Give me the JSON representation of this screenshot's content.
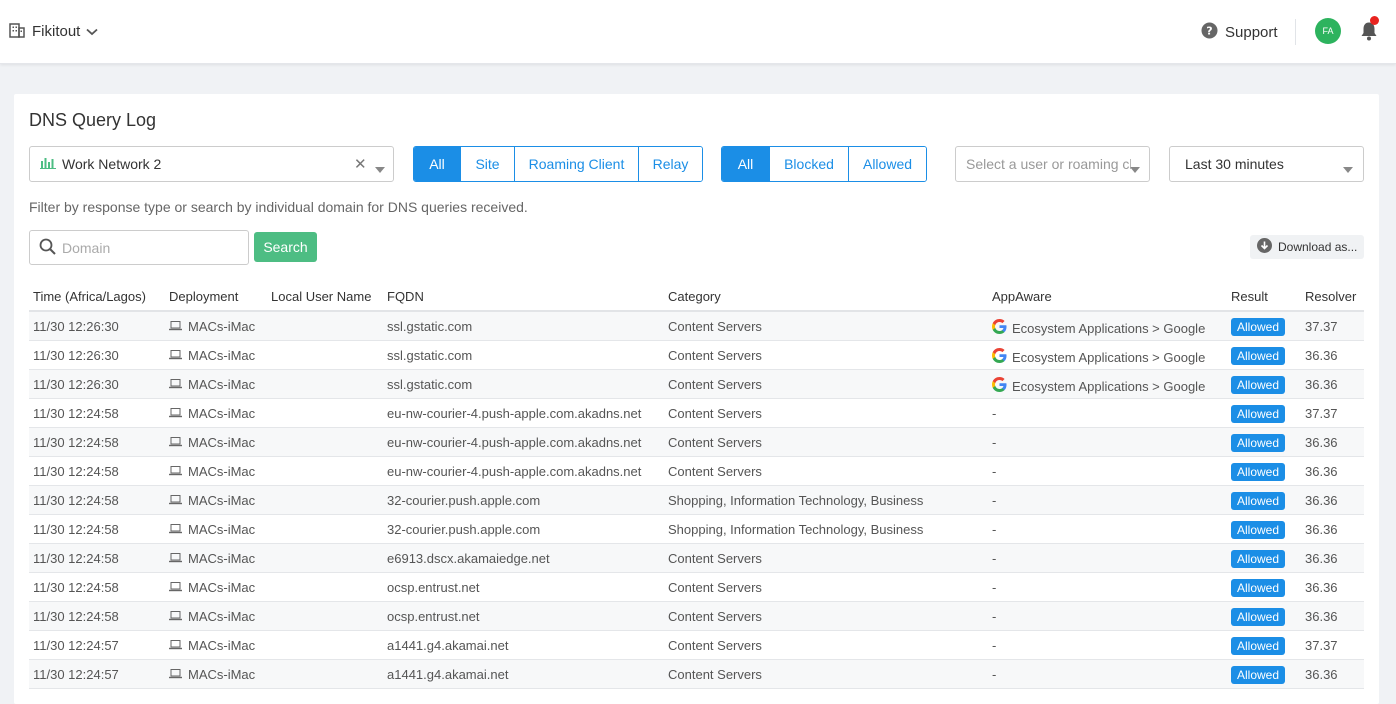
{
  "header": {
    "org_name": "Fikitout",
    "org_icon": "building-icon",
    "support_label": "Support",
    "avatar_initials": "FA",
    "colors": {
      "avatar": "#2db35e",
      "notification_dot": "#e8231f"
    }
  },
  "page": {
    "title": "DNS Query Log"
  },
  "filters": {
    "network": {
      "value": "Work Network 2",
      "icon": "bar-chart-icon"
    },
    "deployment_type": {
      "options": [
        "All",
        "Site",
        "Roaming Client",
        "Relay"
      ],
      "selected": "All"
    },
    "result_type": {
      "options": [
        "All",
        "Blocked",
        "Allowed"
      ],
      "selected": "All"
    },
    "user_select": {
      "placeholder": "Select a user or roaming client"
    },
    "time_range": {
      "value": "Last 30 minutes"
    },
    "help_text": "Filter by response type or search by individual domain for DNS queries received."
  },
  "search": {
    "placeholder": "Domain",
    "button_label": "Search",
    "download_label": "Download as..."
  },
  "colors": {
    "accent": "#1b8ee6",
    "search_button": "#4dbd83"
  },
  "table": {
    "columns": [
      "Time (Africa/Lagos)",
      "Deployment",
      "Local User Name",
      "FQDN",
      "Category",
      "AppAware",
      "Result",
      "Resolver"
    ],
    "rows": [
      {
        "time": "11/30 12:26:30",
        "deployment": "MACs-iMac",
        "user": "",
        "fqdn": "ssl.gstatic.com",
        "category": "Content Servers",
        "appaware": "Ecosystem Applications > Google",
        "app_icon": "google-icon",
        "result": "Allowed",
        "resolver": "37.37"
      },
      {
        "time": "11/30 12:26:30",
        "deployment": "MACs-iMac",
        "user": "",
        "fqdn": "ssl.gstatic.com",
        "category": "Content Servers",
        "appaware": "Ecosystem Applications > Google",
        "app_icon": "google-icon",
        "result": "Allowed",
        "resolver": "36.36"
      },
      {
        "time": "11/30 12:26:30",
        "deployment": "MACs-iMac",
        "user": "",
        "fqdn": "ssl.gstatic.com",
        "category": "Content Servers",
        "appaware": "Ecosystem Applications > Google",
        "app_icon": "google-icon",
        "result": "Allowed",
        "resolver": "36.36"
      },
      {
        "time": "11/30 12:24:58",
        "deployment": "MACs-iMac",
        "user": "",
        "fqdn": "eu-nw-courier-4.push-apple.com.akadns.net",
        "category": "Content Servers",
        "appaware": "-",
        "app_icon": "",
        "result": "Allowed",
        "resolver": "37.37"
      },
      {
        "time": "11/30 12:24:58",
        "deployment": "MACs-iMac",
        "user": "",
        "fqdn": "eu-nw-courier-4.push-apple.com.akadns.net",
        "category": "Content Servers",
        "appaware": "-",
        "app_icon": "",
        "result": "Allowed",
        "resolver": "36.36"
      },
      {
        "time": "11/30 12:24:58",
        "deployment": "MACs-iMac",
        "user": "",
        "fqdn": "eu-nw-courier-4.push-apple.com.akadns.net",
        "category": "Content Servers",
        "appaware": "-",
        "app_icon": "",
        "result": "Allowed",
        "resolver": "36.36"
      },
      {
        "time": "11/30 12:24:58",
        "deployment": "MACs-iMac",
        "user": "",
        "fqdn": "32-courier.push.apple.com",
        "category": "Shopping, Information Technology, Business",
        "appaware": "-",
        "app_icon": "",
        "result": "Allowed",
        "resolver": "36.36"
      },
      {
        "time": "11/30 12:24:58",
        "deployment": "MACs-iMac",
        "user": "",
        "fqdn": "32-courier.push.apple.com",
        "category": "Shopping, Information Technology, Business",
        "appaware": "-",
        "app_icon": "",
        "result": "Allowed",
        "resolver": "36.36"
      },
      {
        "time": "11/30 12:24:58",
        "deployment": "MACs-iMac",
        "user": "",
        "fqdn": "e6913.dscx.akamaiedge.net",
        "category": "Content Servers",
        "appaware": "-",
        "app_icon": "",
        "result": "Allowed",
        "resolver": "36.36"
      },
      {
        "time": "11/30 12:24:58",
        "deployment": "MACs-iMac",
        "user": "",
        "fqdn": "ocsp.entrust.net",
        "category": "Content Servers",
        "appaware": "-",
        "app_icon": "",
        "result": "Allowed",
        "resolver": "36.36"
      },
      {
        "time": "11/30 12:24:58",
        "deployment": "MACs-iMac",
        "user": "",
        "fqdn": "ocsp.entrust.net",
        "category": "Content Servers",
        "appaware": "-",
        "app_icon": "",
        "result": "Allowed",
        "resolver": "36.36"
      },
      {
        "time": "11/30 12:24:57",
        "deployment": "MACs-iMac",
        "user": "",
        "fqdn": "a1441.g4.akamai.net",
        "category": "Content Servers",
        "appaware": "-",
        "app_icon": "",
        "result": "Allowed",
        "resolver": "37.37"
      },
      {
        "time": "11/30 12:24:57",
        "deployment": "MACs-iMac",
        "user": "",
        "fqdn": "a1441.g4.akamai.net",
        "category": "Content Servers",
        "appaware": "-",
        "app_icon": "",
        "result": "Allowed",
        "resolver": "36.36"
      }
    ]
  }
}
